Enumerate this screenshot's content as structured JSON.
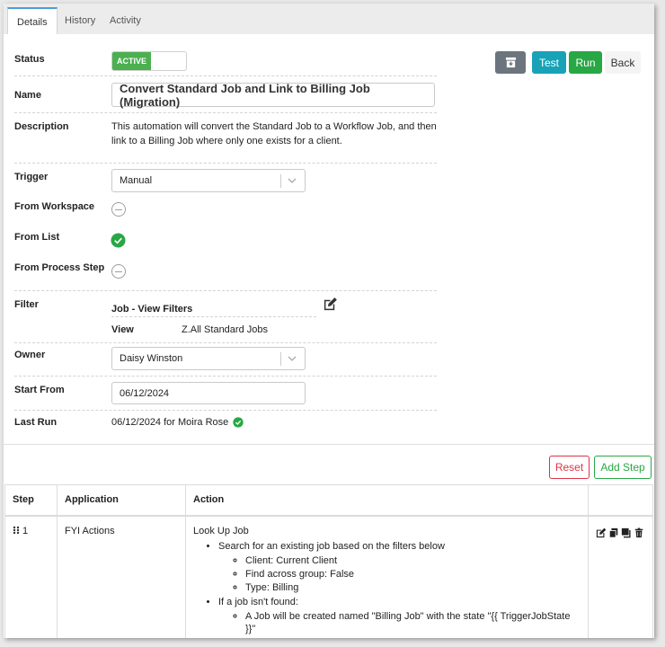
{
  "tabs": [
    {
      "label": "Details",
      "active": true
    },
    {
      "label": "History",
      "active": false
    },
    {
      "label": "Activity",
      "active": false
    }
  ],
  "form": {
    "status": {
      "label": "Status",
      "toggle_text": "ACTIVE",
      "on_color": "#4caf50"
    },
    "name": {
      "label": "Name",
      "value": "Convert Standard Job and Link to Billing Job (Migration)"
    },
    "description": {
      "label": "Description",
      "line1": "This automation will convert the Standard Job to a Workflow Job, and then",
      "line2": "link to a Billing Job where only one exists for a client."
    },
    "trigger": {
      "label": "Trigger",
      "value": "Manual"
    },
    "from_workspace": {
      "label": "From Workspace",
      "checked": false
    },
    "from_list": {
      "label": "From List",
      "checked": true
    },
    "from_process_step": {
      "label": "From Process Step",
      "checked": false
    },
    "filter": {
      "label": "Filter",
      "title": "Job - View Filters",
      "view_label": "View",
      "view_value": "Z.All Standard Jobs"
    },
    "owner": {
      "label": "Owner",
      "value": "Daisy Winston"
    },
    "start_from": {
      "label": "Start From",
      "value": "06/12/2024"
    },
    "last_run": {
      "label": "Last Run",
      "value": "06/12/2024 for Moira Rose"
    }
  },
  "toolbar": {
    "archive_icon": "archive-icon",
    "test_label": "Test",
    "run_label": "Run",
    "back_label": "Back"
  },
  "steps_toolbar": {
    "reset_label": "Reset",
    "add_step_label": "Add Step"
  },
  "steps_table": {
    "headers": {
      "step": "Step",
      "application": "Application",
      "action": "Action"
    },
    "rows": [
      {
        "step": "1",
        "application": "FYI Actions",
        "action_title": "Look Up Job",
        "bullet1": "Search for an existing job based on the filters below",
        "sub1": [
          "Client: Current Client",
          "Find across group: False",
          "Type: Billing"
        ],
        "bullet2": "If a job isn't found:",
        "sub2": [
          "A Job will be created named \"Billing Job\" with the state \"{{ TriggerJobState }}\""
        ]
      }
    ]
  },
  "colors": {
    "accent_blue": "#4a9fd6",
    "test": "#17a2b8",
    "run": "#28a745",
    "archive": "#6c757d",
    "reset": "#dc3545",
    "check_green": "#28a745"
  }
}
